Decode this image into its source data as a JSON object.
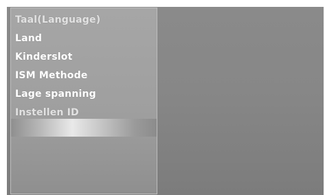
{
  "menu": {
    "items": [
      {
        "label": "Taal(Language)"
      },
      {
        "label": "Land"
      },
      {
        "label": "Kinderslot"
      },
      {
        "label": "ISM Methode"
      },
      {
        "label": "Lage spanning"
      },
      {
        "label": "Instellen ID"
      }
    ]
  },
  "colors": {
    "panel": "#a3a3a3",
    "screen": "#878787",
    "text": "#ffffff"
  }
}
